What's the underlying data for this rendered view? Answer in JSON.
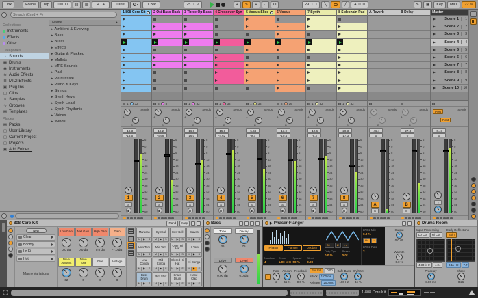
{
  "toolbar": {
    "link": "Link",
    "follow": "Follow",
    "tap": "Tap",
    "tempo": "100.00",
    "nudge": "|||",
    "time_sig": "4 / 4",
    "groove_amount": "100%",
    "quantize": "1 Bar",
    "arrangement_position": "25. 1. 2",
    "loop_start": "29. 1. 1",
    "loop_length": "4. 0. 0",
    "key": "Key",
    "midi": "MIDI",
    "cpu": "22 %",
    "icons": {
      "plus": "+",
      "capture": "O",
      "punch_in": "╲",
      "punch_out": "╱",
      "nudge_l": "|||",
      "nudge_r": "|||"
    }
  },
  "browser": {
    "search_placeholder": "Search (Cmd + F)",
    "collections_label": "Collections",
    "collections": [
      {
        "label": "Instruments",
        "color": "#45d07a"
      },
      {
        "label": "Effects",
        "color": "#54a9f0"
      },
      {
        "label": "Other",
        "color": "#b88df0"
      }
    ],
    "categories_label": "Categories",
    "categories": [
      {
        "label": "Sounds",
        "icon": "♪",
        "selected": true
      },
      {
        "label": "Drums",
        "icon": "▦"
      },
      {
        "label": "Instruments",
        "icon": "◉"
      },
      {
        "label": "Audio Effects",
        "icon": "≋"
      },
      {
        "label": "MIDI Effects",
        "icon": "≣"
      },
      {
        "label": "Plug-Ins",
        "icon": "▣"
      },
      {
        "label": "Clips",
        "icon": "◫"
      },
      {
        "label": "Samples",
        "icon": "≈"
      },
      {
        "label": "Grooves",
        "icon": "∿"
      },
      {
        "label": "Templates",
        "icon": "▤"
      }
    ],
    "places_label": "Places",
    "places": [
      {
        "label": "Packs",
        "icon": "▤"
      },
      {
        "label": "User Library",
        "icon": "▢"
      },
      {
        "label": "Current Project",
        "icon": "▢"
      },
      {
        "label": "Projects",
        "icon": "▢"
      },
      {
        "label": "Add Folder...",
        "icon": "▣",
        "underline": true
      }
    ],
    "name_header": "Name",
    "items": [
      "Ambient & Evolving",
      "Bass",
      "Brass",
      "Effects",
      "Guitar & Plucked",
      "Mallets",
      "MPE Sounds",
      "Pad",
      "Percussive",
      "Piano & Keys",
      "Strings",
      "Synth Keys",
      "Synth Lead",
      "Synth Rhythmic",
      "Voices",
      "Winds"
    ]
  },
  "session": {
    "tracks": [
      {
        "name": "1 808 Core Kit",
        "color": "#84c5f2",
        "clip_color": "#84c5f2",
        "freeze": true,
        "slots": [
          "clip",
          "clip",
          "clip",
          "playing",
          "clip",
          "clip",
          "clip",
          "clip",
          "clip",
          "clip"
        ]
      },
      {
        "name": "2 Osi Bass Rack",
        "color": "#ee7bee",
        "clip_color": "#ee7bee",
        "freeze": false,
        "slots": [
          "empty",
          "clip",
          "clip",
          "playing",
          "empty",
          "clip",
          "clip",
          "empty",
          "empty",
          "empty"
        ]
      },
      {
        "name": "3 Three-Op Bass",
        "color": "#ee7bee",
        "clip_color": "#ee7bee",
        "freeze": false,
        "slots": [
          "empty",
          "clip",
          "clip",
          "playing",
          "empty",
          "clip",
          "clip",
          "empty",
          "empty",
          "empty"
        ]
      },
      {
        "name": "4 Crossover Syn",
        "color": "#f25c9b",
        "clip_color": "#f25c9b",
        "freeze": false,
        "slots": [
          "empty",
          "empty",
          "empty",
          "playing",
          "empty",
          "clip",
          "clip",
          "clip",
          "clip",
          "empty"
        ]
      },
      {
        "name": "5 Vocals Slice",
        "color": "#e3e37b",
        "clip_color": "#f5a273",
        "freeze": true,
        "slots": [
          "clip",
          "clip",
          "empty",
          "playing",
          "clip",
          "empty",
          "clip",
          "clip",
          "clip",
          "empty"
        ]
      },
      {
        "name": "6 Vocals",
        "color": "#f5a273",
        "clip_color": "#f5a273",
        "freeze": false,
        "slots": [
          "empty",
          "clip",
          "clip",
          "playing",
          "clip",
          "empty",
          "clip",
          "clip",
          "clip",
          "clip"
        ]
      },
      {
        "name": "7 Synth",
        "color": "#e9ebab",
        "clip_color": "#eef0be",
        "freeze": false,
        "slots": [
          "clip",
          "clip",
          "empty",
          "playing",
          "clip",
          "empty",
          "clip",
          "clip",
          "clip",
          "empty"
        ]
      },
      {
        "name": "8 Sidechain Pad",
        "color": "#e9ebab",
        "clip_color": "#eef0be",
        "freeze": false,
        "slots": [
          "empty",
          "clip",
          "clip",
          "playing",
          "clip",
          "clip",
          "clip",
          "clip",
          "clip",
          "clip"
        ]
      }
    ],
    "returns": [
      {
        "name": "A Reverb"
      },
      {
        "name": "B Delay"
      }
    ],
    "master_label": "Master",
    "scenes": [
      {
        "label": "Scene 1",
        "num": "1"
      },
      {
        "label": "Scene 2",
        "num": "2"
      },
      {
        "label": "Scene 3",
        "num": "3"
      },
      {
        "label": "Scene 4",
        "num": "4",
        "selected": true
      },
      {
        "label": "Scene 5",
        "num": "5"
      },
      {
        "label": "Scene 6",
        "num": "6"
      },
      {
        "label": "Scene 7",
        "num": "7"
      },
      {
        "label": "Scene 8",
        "num": "8"
      },
      {
        "label": "Scene 9",
        "num": "9"
      },
      {
        "label": "Scene 10",
        "num": "10"
      }
    ]
  },
  "mixer": {
    "sends_label": "Sends",
    "send_a": "A",
    "send_b": "B",
    "solo_label": "S",
    "post_labels": [
      "Post",
      "Post"
    ],
    "scale": [
      "6",
      "0",
      "6",
      "12",
      "18",
      "24",
      "30",
      "36",
      "42",
      "48",
      "54",
      "60"
    ],
    "strips": [
      {
        "kind": "track",
        "num": "1",
        "io": [
          "1",
          "32"
        ],
        "peak": "-19.3",
        "vol": "-13.5",
        "meter": 0.8,
        "fader": 0.3
      },
      {
        "kind": "track",
        "num": "2",
        "io": [
          "3",
          "8"
        ],
        "peak": "-19.2",
        "vol": "-4.98",
        "meter": 0.45,
        "fader": 0.22
      },
      {
        "kind": "track",
        "num": "3",
        "io": [
          "1",
          "32"
        ],
        "peak": "-16.9",
        "vol": "-16.0",
        "meter": 0.72,
        "fader": 0.35
      },
      {
        "kind": "track",
        "num": "4",
        "io": [
          "1",
          "32"
        ],
        "peak": "-15.0",
        "vol": "-4.62",
        "meter": 0.85,
        "fader": 0.21
      },
      {
        "kind": "track",
        "num": "5",
        "io": [
          "1",
          "32"
        ],
        "peak": "-5.34",
        "vol": "-9.3",
        "meter": 0.6,
        "fader": 0.27
      },
      {
        "kind": "track",
        "num": "6",
        "io": [
          "2",
          "16"
        ],
        "peak": "-13.9",
        "vol": "-10.4",
        "meter": 0.7,
        "fader": 0.28
      },
      {
        "kind": "track",
        "num": "7",
        "io": [
          "1",
          "32"
        ],
        "peak": "-12.6",
        "vol": "-9.3",
        "meter": 0.78,
        "fader": 0.27
      },
      {
        "kind": "track",
        "num": "8",
        "io": [
          "1",
          "32"
        ],
        "peak": "-20.3",
        "vol": "-17.3",
        "meter": 0.55,
        "fader": 0.36
      },
      {
        "kind": "return",
        "num": "A",
        "io": [
          "",
          ""
        ],
        "peak": "-46.4",
        "vol": "0",
        "meter": 0.05,
        "fader": 0.17
      },
      {
        "kind": "return",
        "num": "B",
        "io": [
          "",
          ""
        ],
        "peak": "-27.3",
        "vol": "0",
        "meter": 0.4,
        "fader": 0.17
      },
      {
        "kind": "master",
        "num": "",
        "io": [
          "",
          ""
        ],
        "peak": "-0.47",
        "vol": "0",
        "meter": 0.88,
        "fader": 0.17
      }
    ]
  },
  "right_strip": {
    "dots": [
      "#2e2e2e",
      "#f0a030",
      "#f0a030",
      "#f0a030",
      "#2e2e2e",
      "#2e2e2e",
      "#f0a030"
    ]
  },
  "devices": {
    "drum_rack": {
      "title": "808 Core Kit",
      "rand": "Rand",
      "map": "Map",
      "new_label": "New",
      "variations": [
        "Clean",
        "Boomy",
        "Lo Fi",
        "Hot"
      ],
      "variations_label": "Macro Variations",
      "macros": [
        {
          "label": "Low Gain",
          "value": "0.0 dB",
          "color": "#f0886c"
        },
        {
          "label": "Mid Gain",
          "value": "0.0 dB",
          "color": "#f0886c"
        },
        {
          "label": "High Gain",
          "value": "0.0 dB",
          "color": "#f0886c"
        },
        {
          "label": "Gain",
          "value": "-7.0 dB",
          "color": "#f5b08a"
        },
        {
          "label": "Drive Amount",
          "value": "62",
          "color": "#f2ee6e"
        },
        {
          "label": "Drive Tone",
          "value": "0",
          "color": "#f2ee6e"
        },
        {
          "label": "Glue",
          "value": "0",
          "color": "#d8d8d8"
        },
        {
          "label": "Vintage",
          "value": "0",
          "color": "#d8d8d8"
        }
      ],
      "pad_buttons": [
        "M",
        "▶",
        "S"
      ],
      "pads": [
        {
          "name": "Maracas"
        },
        {
          "name": "Cymbal"
        },
        {
          "name": "Cow Bell"
        },
        {
          "name": "Claves"
        },
        {
          "name": "Low Tom"
        },
        {
          "name": "Mid Tom"
        },
        {
          "name": "Open Hi Hat"
        },
        {
          "name": "Hi Tom"
        },
        {
          "name": "Low Conga"
        },
        {
          "name": "Mid Conga"
        },
        {
          "name": "Closed Hi Hat"
        },
        {
          "name": "Hi-Conga",
          "playing": true
        },
        {
          "name": "Bass Drum",
          "selected": true
        },
        {
          "name": "Rim Shot"
        },
        {
          "name": "Snare Drum"
        },
        {
          "name": "Hand Clap"
        }
      ]
    },
    "bass": {
      "title": "Bass",
      "cells": [
        {
          "label": "Tone",
          "value": "36",
          "lcolor": "#ececec",
          "blue": true
        },
        {
          "label": "Decay",
          "value": "75",
          "lcolor": "#ececec",
          "blue": true
        },
        {
          "label": "Drive",
          "value": "0.00 dB",
          "lcolor": "#a2a2a2",
          "blue": false
        },
        {
          "label": "Level",
          "value": "0.0 dB",
          "lcolor": "#f0876d",
          "blue": true
        }
      ]
    },
    "phaser": {
      "title": "Phaser-Flanger",
      "modes": [
        {
          "label": "Phaser",
          "on": true
        },
        {
          "label": "Flanger",
          "on": false
        },
        {
          "label": "Doubler",
          "on": false
        }
      ],
      "params": [
        {
          "label": "Notches",
          "value": "4"
        },
        {
          "label": "Center",
          "value": "1.00 kHz"
        },
        {
          "label": "Spread",
          "value": "50 %"
        },
        {
          "label": "Blend",
          "value": "0.00"
        }
      ],
      "wave_shape": "Tri",
      "wave_arrow": "▾",
      "phase_icon": "Ø",
      "stereo_icon": "◖◗",
      "duty_label": "Duty Cyc",
      "duty": "0.0 %",
      "phase_label": "Phase",
      "phase": "0.0°",
      "lfo2_mix_label": "LFO2 Mix",
      "lfo2_mix": "0.0 %",
      "hz_label": "Hz",
      "note_icon": "♪",
      "lfo2_rate_label": "LFO2 Rate",
      "lfo2_rate": "2",
      "output_label": "Output",
      "output": "0.0 dB",
      "warmth_label": "Warmth",
      "warmth": "0.0 %",
      "drywet_label": "Dry/Wet",
      "drywet": "34 %",
      "rate_label": "Rate",
      "rate": "2",
      "amount_label": "Amount",
      "amount": "65 %",
      "feedback_label": "Feedback",
      "feedback": "0.0 %",
      "env_label": "Env Fol",
      "env_amount": "0.00",
      "attack_label": "Attack",
      "attack": "1.00 ms",
      "release_label": "Release",
      "release": "200 ms",
      "safebass_label": "Safe Bass",
      "safebass": "100 Hz",
      "bars": [
        8,
        14,
        6,
        18,
        10,
        20,
        7,
        16,
        12,
        19,
        9,
        15
      ]
    },
    "reverb": {
      "title": "Drums Room",
      "input_label": "Input Processing",
      "lo_cut": "Lo Cut",
      "hi_cut": "Hi Cut",
      "input_vals": [
        "4.33 kHz",
        "4.04"
      ],
      "er_label": "Early Reflections",
      "spin": "Spin",
      "er_vals": [
        "0.11 Hz",
        "7.7"
      ],
      "predelay_label": "Predelay",
      "predelay": "8.00 ms",
      "shape_label": "Shape",
      "shape": "0.26"
    },
    "status_chain": "1-808 Core Kit"
  },
  "colors": {
    "accent": "#f0a030",
    "play_green": "#35d04a",
    "meter_green": "#2bd048",
    "selection_blue": "#bfd3e2"
  }
}
